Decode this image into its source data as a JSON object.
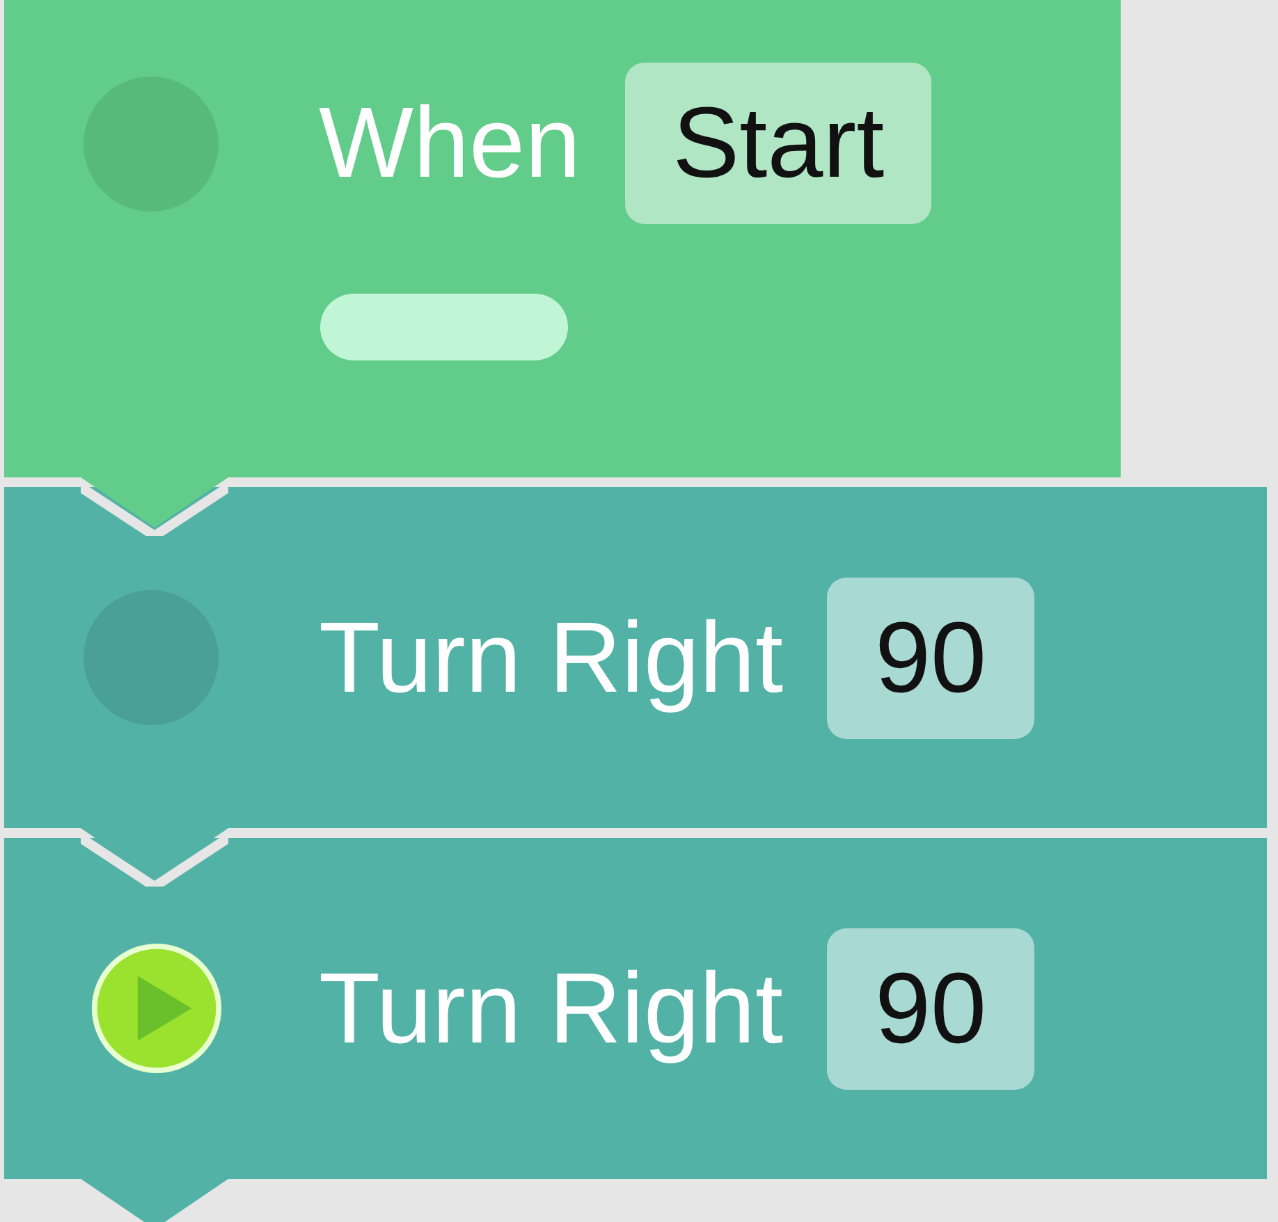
{
  "blocks": [
    {
      "kind": "event",
      "label": "When",
      "value": "Start",
      "running": false,
      "color": "#62cd8a"
    },
    {
      "kind": "action",
      "label": "Turn Right",
      "value": "90",
      "running": false,
      "color": "#52b2a6"
    },
    {
      "kind": "action",
      "label": "Turn Right",
      "value": "90",
      "running": true,
      "color": "#52b2a6"
    }
  ]
}
